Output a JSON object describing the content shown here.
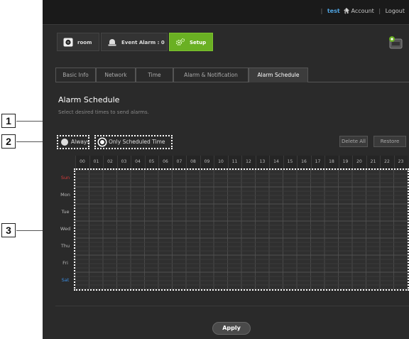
{
  "callouts": {
    "one": "1",
    "two": "2",
    "three": "3"
  },
  "topbar": {
    "home_icon": "home-icon",
    "separator": "|",
    "user": "test",
    "account": "Account",
    "logout": "Logout"
  },
  "camera_bar": {
    "room_label": "room",
    "event_alarm_label": "Event Alarm : 0",
    "setup_label": "Setup"
  },
  "tabs": [
    {
      "label": "Basic Info"
    },
    {
      "label": "Network"
    },
    {
      "label": "Time"
    },
    {
      "label": "Alarm & Notification"
    },
    {
      "label": "Alarm Schedule"
    }
  ],
  "page": {
    "title": "Alarm Schedule",
    "subtitle": "Select desired times to send alarms."
  },
  "options": {
    "always": "Always",
    "only_scheduled": "Only Scheduled Time",
    "selected": "only_scheduled"
  },
  "actions": {
    "delete_all": "Delete All",
    "restore": "Restore"
  },
  "schedule": {
    "hours": [
      "00",
      "01",
      "02",
      "03",
      "04",
      "05",
      "06",
      "07",
      "08",
      "09",
      "10",
      "11",
      "12",
      "13",
      "14",
      "15",
      "16",
      "17",
      "18",
      "19",
      "20",
      "21",
      "22",
      "23"
    ],
    "days": [
      "Sun",
      "Mon",
      "Tue",
      "Wed",
      "Thu",
      "Fri",
      "Sat"
    ]
  },
  "footer": {
    "apply": "Apply"
  },
  "colors": {
    "setup_accent": "#6ab023",
    "user_link": "#4fa3e0",
    "sunday": "#d83b3b",
    "saturday": "#3b8fe6"
  }
}
